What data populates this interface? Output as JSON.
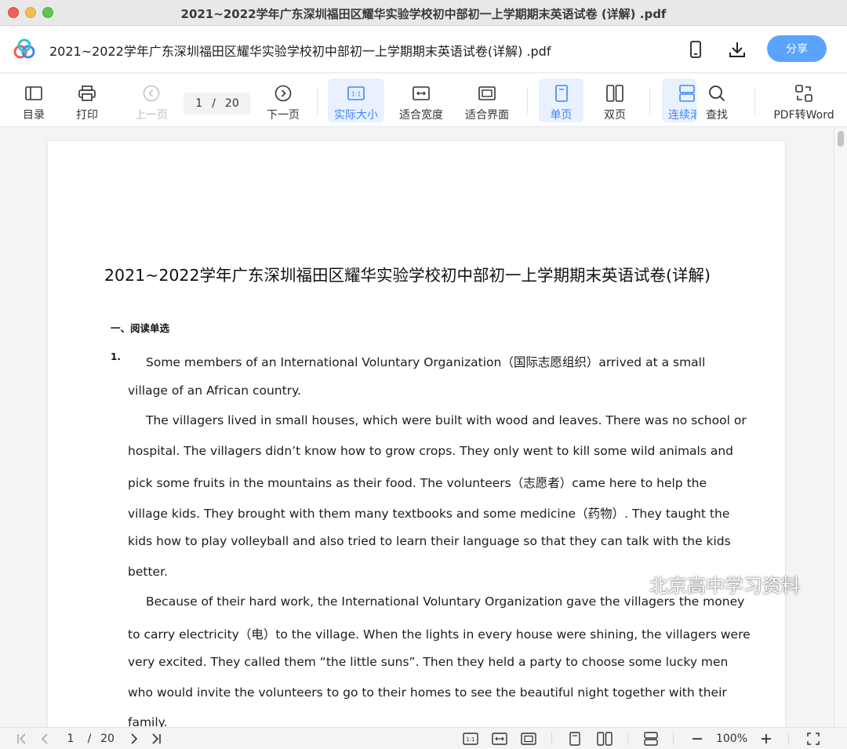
{
  "window": {
    "title": "2021~2022学年广东深圳福田区耀华实验学校初中部初一上学期期末英语试卷 (详解) .pdf"
  },
  "header": {
    "doc_title": "2021~2022学年广东深圳福田区耀华实验学校初中部初一上学期期末英语试卷(详解) .pdf",
    "share_label": "分享",
    "icons": [
      "phone-icon",
      "download-icon"
    ]
  },
  "toolbar": {
    "toc": "目录",
    "print": "打印",
    "prev": "上一页",
    "page_current": "1",
    "page_sep": "/",
    "page_total": "20",
    "next": "下一页",
    "actual_size": "实际大小",
    "fit_width": "适合宽度",
    "fit_page": "适合界面",
    "single": "单页",
    "double": "双页",
    "continuous": "连续滚",
    "find": "查找",
    "pdf_to_word": "PDF转Word",
    "accent": "#3f87f5"
  },
  "document": {
    "title": "2021~2022学年广东深圳福田区耀华实验学校初中部初一上学期期末英语试卷(详解)",
    "section": "一、阅读单选",
    "question_number": "1.",
    "lines": [
      "Some members of an International Voluntary Organization（国际志愿组织）arrived at a small",
      "village of an African country.",
      "The villagers lived in small houses, which were built with wood and leaves. There was no school or",
      "hospital. The villagers didn’t know how to grow crops. They only went to kill some wild animals and",
      "pick some fruits in the mountains as their food. The volunteers（志愿者）came here to help the",
      "village kids. They brought with them many textbooks and some medicine（药物）. They taught the",
      "kids how to play volleyball and also tried to learn their language so that they can talk with the kids",
      "better.",
      "Because of their hard work, the International Voluntary Organization gave the villagers the money",
      "to carry electricity（电）to the village. When the lights in every house were shining, the villagers were",
      "very excited. They called them “the little suns”. Then they held a party to choose some lucky men",
      "who would invite the volunteers to go to their homes to see the beautiful night together with their",
      "family."
    ]
  },
  "watermark": {
    "text": "北京高中学习资料"
  },
  "statusbar": {
    "page_current": "1",
    "page_sep": "/",
    "page_total": "20",
    "zoom": "100%"
  }
}
